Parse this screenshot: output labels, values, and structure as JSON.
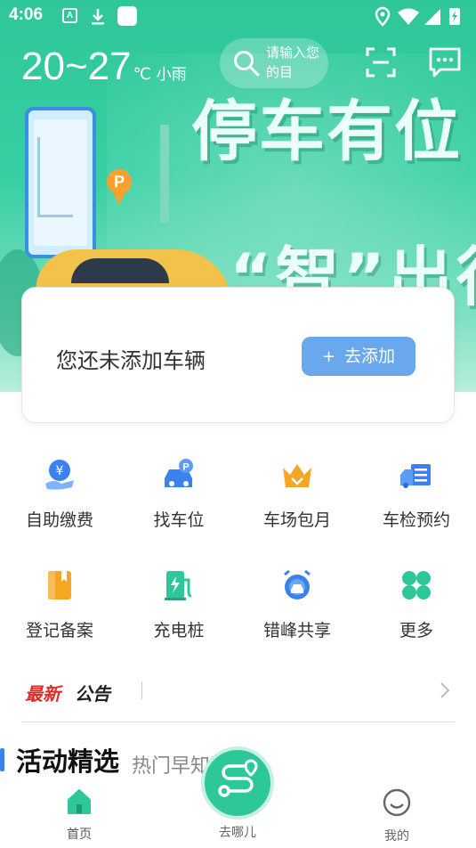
{
  "status_bar": {
    "time": "4:06",
    "icons": [
      "a-notification-icon",
      "download-icon",
      "app-square-icon",
      "location-icon",
      "wifi-icon",
      "signal-icon",
      "battery-charging-icon"
    ]
  },
  "header": {
    "temperature": "20~27",
    "unit": "℃",
    "condition": "小雨",
    "search_placeholder": "请输入您的目"
  },
  "banner": {
    "slogan_line1": "停车有位",
    "slogan_line2": "“智”出行",
    "pin_letter": "P"
  },
  "vehicle_card": {
    "message": "您还未添加车辆",
    "add_label": "去添加",
    "add_symbol": "+"
  },
  "services": [
    {
      "label": "自助缴费",
      "icon": "self-pay-icon",
      "color": "#3b82f0"
    },
    {
      "label": "找车位",
      "icon": "find-parking-icon",
      "color": "#3b82f0"
    },
    {
      "label": "车场包月",
      "icon": "monthly-crown-icon",
      "color": "#f5a623"
    },
    {
      "label": "车检预约",
      "icon": "inspection-truck-icon",
      "color": "#3b82f0"
    },
    {
      "label": "登记备案",
      "icon": "register-book-icon",
      "color": "#f5a623"
    },
    {
      "label": "充电桩",
      "icon": "charging-pile-icon",
      "color": "#2ec79a"
    },
    {
      "label": "错峰共享",
      "icon": "shared-alarm-icon",
      "color": "#3b82f0"
    },
    {
      "label": "更多",
      "icon": "more-clover-icon",
      "color": "#2ec79a"
    }
  ],
  "announcement": {
    "title_red": "最新",
    "title_black": "公告"
  },
  "activities": {
    "title": "活动精选",
    "subtitle": "热门早知道"
  },
  "bottom_nav": {
    "home": "首页",
    "where": "去哪儿",
    "mine": "我的"
  },
  "colors": {
    "brand_green": "#2ec79a",
    "accent_blue": "#6aa8ee",
    "announce_red": "#e02a2a"
  }
}
